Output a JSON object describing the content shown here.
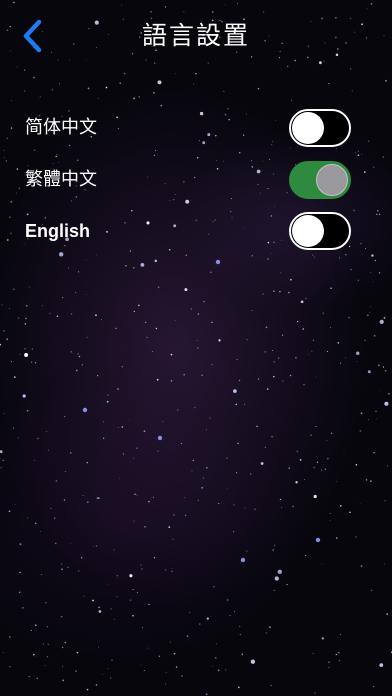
{
  "header": {
    "title": "語言設置",
    "back_icon": "chevron-left-icon",
    "accent_color": "#1e7cf0"
  },
  "languages": [
    {
      "label": "简体中文",
      "enabled": false
    },
    {
      "label": "繁體中文",
      "enabled": true
    },
    {
      "label": "English",
      "enabled": false
    }
  ],
  "colors": {
    "toggle_on": "#2e8a3e",
    "toggle_off_border": "#ffffff",
    "background": "#07060d"
  }
}
